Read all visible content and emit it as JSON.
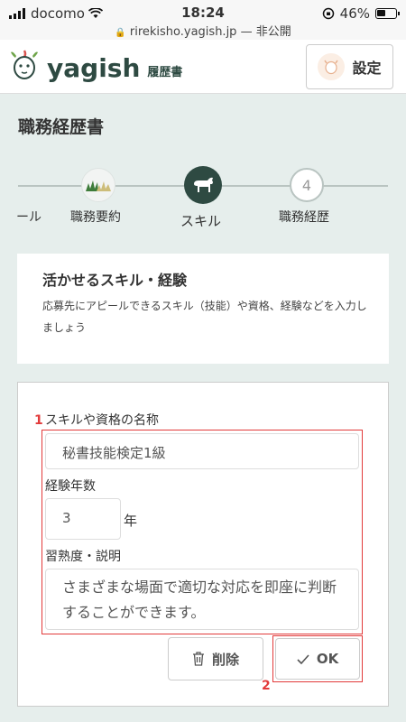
{
  "status_bar": {
    "carrier": "docomo",
    "time": "18:24",
    "url": "rirekisho.yagish.jp — 非公開",
    "battery": "46%"
  },
  "header": {
    "logo_text": "yagish",
    "logo_sub": "履歴書",
    "settings_label": "設定"
  },
  "page": {
    "title": "職務経歴書"
  },
  "steps": [
    {
      "label": "ール"
    },
    {
      "label": "職務要約"
    },
    {
      "label": "スキル"
    },
    {
      "label": "職務経歴",
      "number": "4"
    }
  ],
  "skills_section": {
    "title": "活かせるスキル・経験",
    "description": "応募先にアピールできるスキル（技能）や資格、経験などを入力しましょう"
  },
  "form": {
    "skill_name_label": "スキルや資格の名称",
    "skill_name_value": "秘書技能検定1級",
    "years_label": "経験年数",
    "years_value": "3",
    "years_unit": "年",
    "proficiency_label": "習熟度・説明",
    "proficiency_value": "さまざまな場面で適切な対応を即座に判断することができます。",
    "delete_label": "削除",
    "ok_label": "OK"
  },
  "annotations": {
    "marker1": "1",
    "marker2": "2"
  },
  "colors": {
    "accent": "#2e4a42",
    "highlight": "#e23a3a",
    "background": "#e6eeec"
  }
}
